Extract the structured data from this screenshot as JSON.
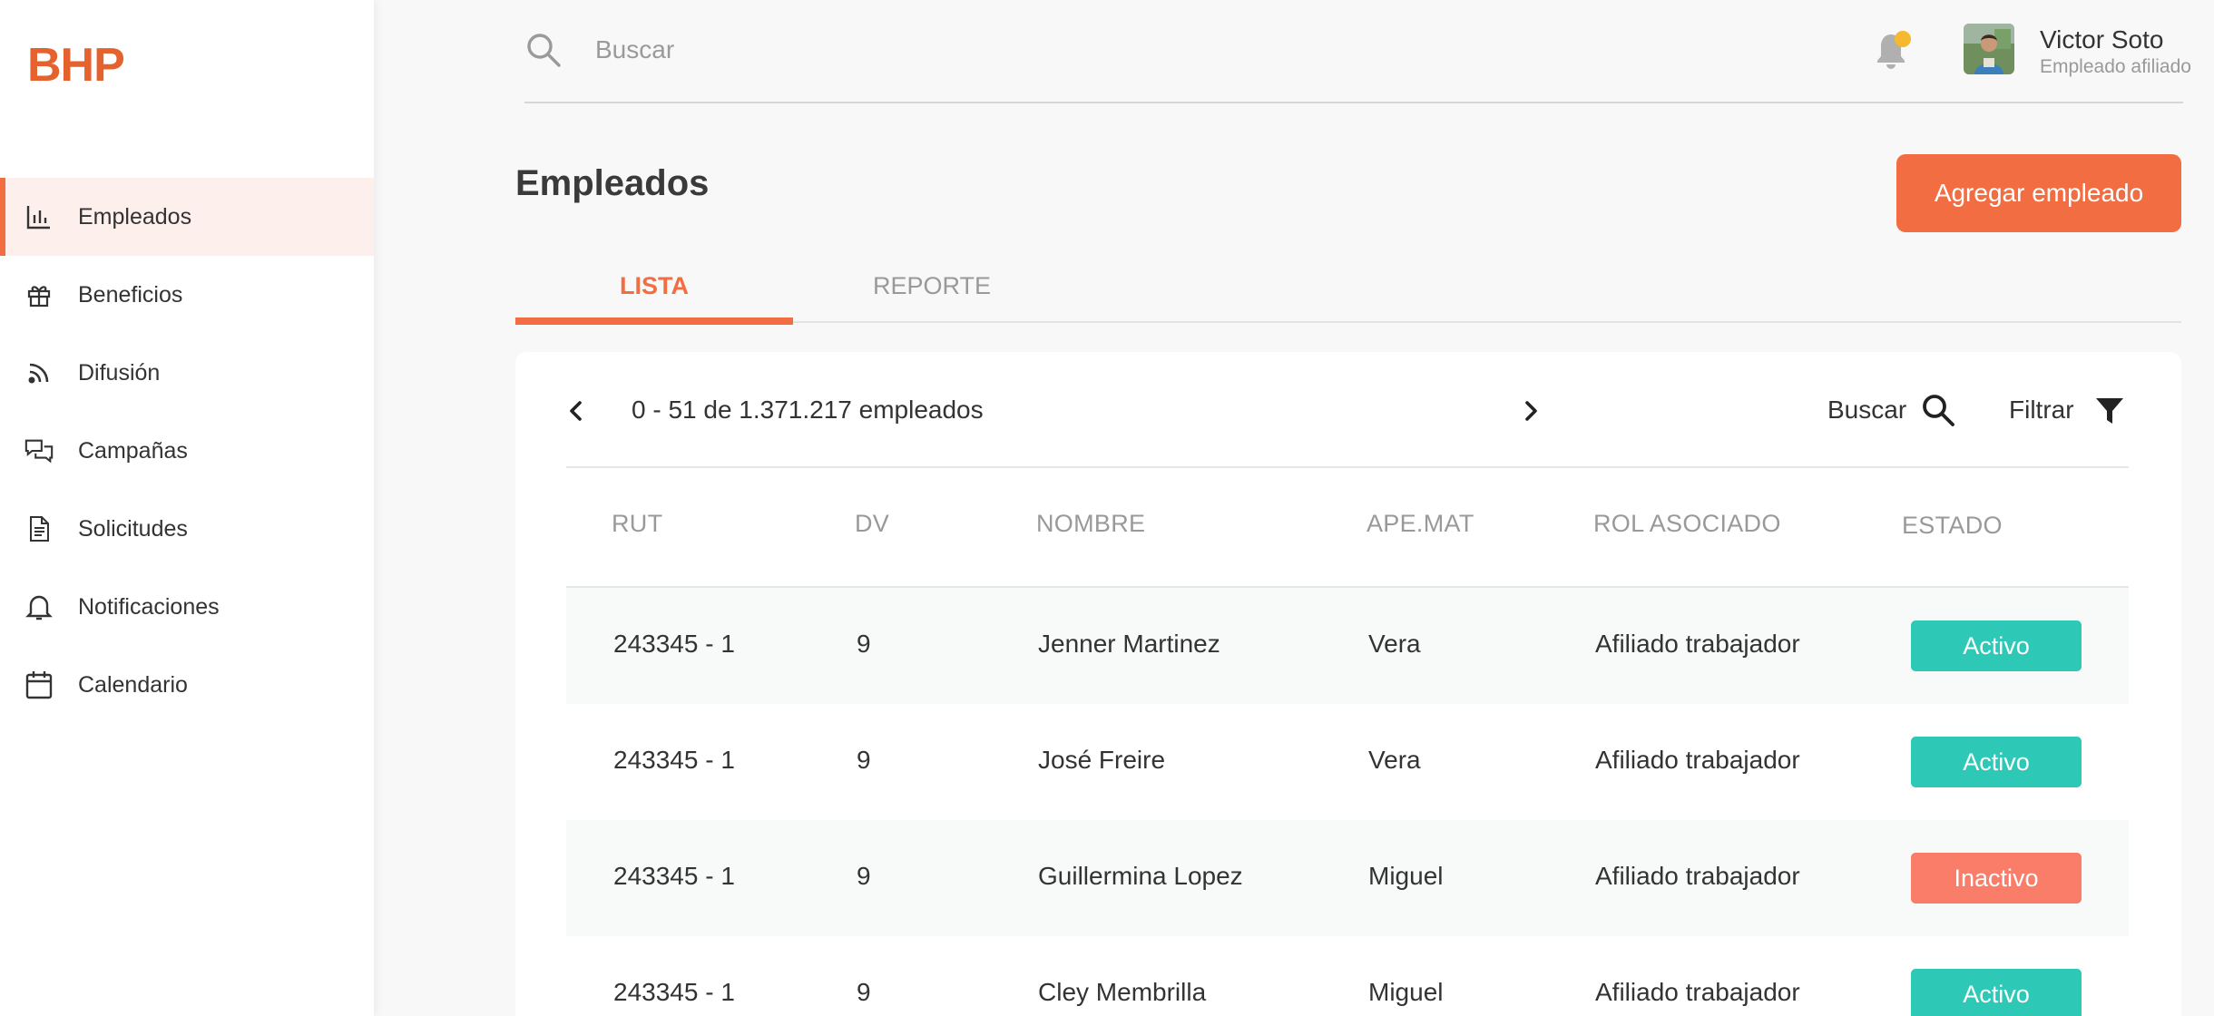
{
  "app": {
    "logo": "BHP"
  },
  "sidebar": {
    "items": [
      {
        "label": "Empleados",
        "icon": "bar-chart-icon",
        "active": true
      },
      {
        "label": "Beneficios",
        "icon": "gift-icon",
        "active": false
      },
      {
        "label": "Difusión",
        "icon": "rss-icon",
        "active": false
      },
      {
        "label": "Campañas",
        "icon": "chat-bubbles-icon",
        "active": false
      },
      {
        "label": "Solicitudes",
        "icon": "document-icon",
        "active": false
      },
      {
        "label": "Notificaciones",
        "icon": "bell-icon",
        "active": false
      },
      {
        "label": "Calendario",
        "icon": "calendar-icon",
        "active": false
      }
    ]
  },
  "topbar": {
    "search_placeholder": "Buscar",
    "user": {
      "name": "Victor Soto",
      "role": "Empleado afiliado"
    },
    "notification_dot_color": "#f5b82e"
  },
  "page": {
    "title": "Empleados",
    "add_button": "Agregar empleado",
    "tabs": [
      {
        "label": "LISTA",
        "active": true
      },
      {
        "label": "REPORTE",
        "active": false
      }
    ]
  },
  "table_toolbar": {
    "pagination": "0 - 51 de 1.371.217 empleados",
    "search_label": "Buscar",
    "filter_label": "Filtrar"
  },
  "table": {
    "columns": [
      "RUT",
      "DV",
      "NOMBRE",
      "APE.MAT",
      "ROL ASOCIADO",
      "ESTADO"
    ],
    "rows": [
      {
        "rut": "243345 - 1",
        "dv": "9",
        "nombre": "Jenner Martinez",
        "apemat": "Vera",
        "rol": "Afiliado trabajador",
        "estado": "Activo"
      },
      {
        "rut": "243345 - 1",
        "dv": "9",
        "nombre": "José Freire",
        "apemat": "Vera",
        "rol": "Afiliado trabajador",
        "estado": "Activo"
      },
      {
        "rut": "243345 - 1",
        "dv": "9",
        "nombre": "Guillermina Lopez",
        "apemat": "Miguel",
        "rol": "Afiliado trabajador",
        "estado": "Inactivo"
      },
      {
        "rut": "243345 - 1",
        "dv": "9",
        "nombre": "Cley Membrilla",
        "apemat": "Miguel",
        "rol": "Afiliado trabajador",
        "estado": "Activo"
      }
    ]
  },
  "colors": {
    "accent": "#f26e42",
    "logo": "#e5612e",
    "status_active": "#2ec9b6",
    "status_inactive": "#fa7d6a"
  }
}
